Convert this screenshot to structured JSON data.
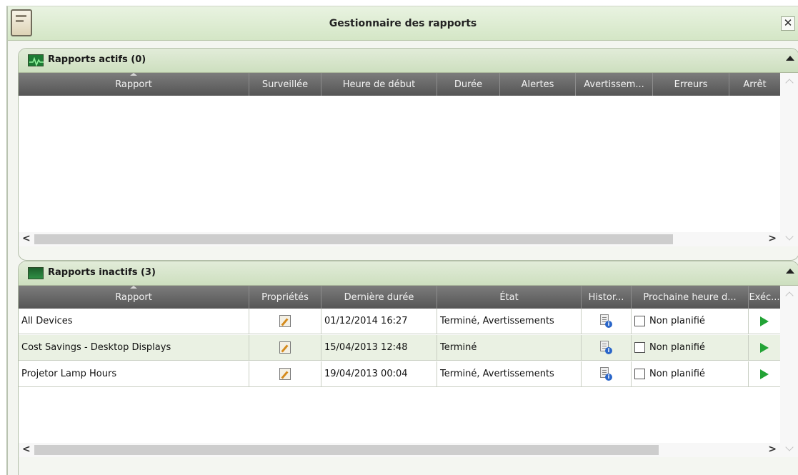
{
  "window": {
    "title": "Gestionnaire des rapports",
    "close_label": "✕"
  },
  "active_panel": {
    "title": "Rapports actifs (0)",
    "columns": [
      "Rapport",
      "Surveillée",
      "Heure de début",
      "Durée",
      "Alertes",
      "Avertissem...",
      "Erreurs",
      "Arrêt"
    ]
  },
  "inactive_panel": {
    "title": "Rapports inactifs (3)",
    "columns": [
      "Rapport",
      "Propriétés",
      "Dernière durée",
      "État",
      "Histor...",
      "Prochaine heure d...",
      "Exéc..."
    ],
    "rows": [
      {
        "name": "All Devices",
        "last_time": "01/12/2014 16:27",
        "state": "Terminé, Avertissements",
        "schedule": "Non planifié",
        "scheduled": false
      },
      {
        "name": "Cost Savings - Desktop Displays",
        "last_time": "15/04/2013 12:48",
        "state": "Terminé",
        "schedule": "Non planifié",
        "scheduled": false
      },
      {
        "name": "Projetor Lamp Hours",
        "last_time": "19/04/2013 00:04",
        "state": "Terminé, Avertissements",
        "schedule": "Non planifié",
        "scheduled": false
      }
    ]
  },
  "scrollbar": {
    "left_arrow": "<",
    "right_arrow": ">"
  },
  "colors": {
    "header_bg": "#666666",
    "alt_row": "#eaf1e3",
    "run_green": "#23a336",
    "title_bar": "#d8e8cb"
  },
  "icons": {
    "app": "report-book-icon",
    "active_panel": "monitor-activity-icon",
    "inactive_panel": "monitor-inactive-icon",
    "properties": "edit-document-icon",
    "history": "document-info-icon",
    "run": "play-icon"
  }
}
